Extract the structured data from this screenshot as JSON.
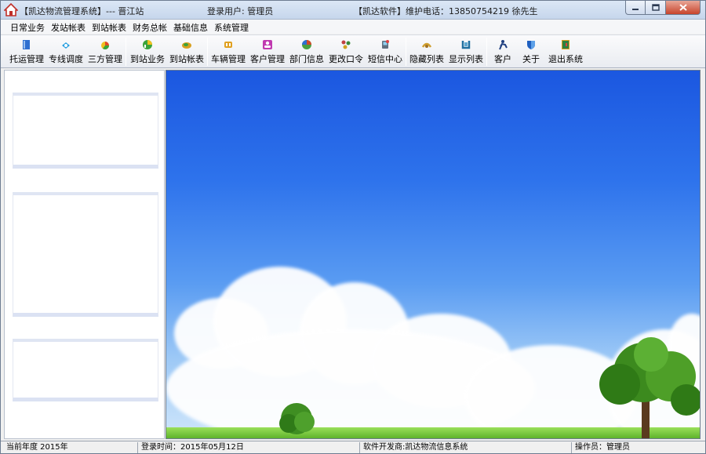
{
  "window": {
    "title_app": "【凯达物流管理系统】--- 晋江站",
    "title_user": "登录用户: 管理员",
    "title_support": "【凯达软件】维护电话：13850754219   徐先生"
  },
  "menu": [
    "日常业务",
    "发站帐表",
    "到站帐表",
    "财务总帐",
    "基础信息",
    "系统管理"
  ],
  "toolbar": [
    {
      "label": "托运管理",
      "icon": "book-icon",
      "color": "#2f6fd0"
    },
    {
      "label": "专线调度",
      "icon": "dispatch-icon",
      "color": "#2aa0e0"
    },
    {
      "label": "三方管理",
      "icon": "pie-chart-icon",
      "color": "#e04a2a"
    },
    {
      "label": "到站业务",
      "icon": "chart-icon",
      "color": "#3aa33a"
    },
    {
      "label": "到站帐表",
      "icon": "report-icon",
      "color": "#d8a020"
    },
    {
      "label": "车辆管理",
      "icon": "truck-icon",
      "color": "#e0a020"
    },
    {
      "label": "客户管理",
      "icon": "customer-icon",
      "color": "#c03ab0"
    },
    {
      "label": "部门信息",
      "icon": "department-icon",
      "color": "#d04a2a"
    },
    {
      "label": "更改口令",
      "icon": "key-icon",
      "color": "#c04040"
    },
    {
      "label": "短信中心",
      "icon": "sms-icon",
      "color": "#607080"
    },
    {
      "label": "隐藏列表",
      "icon": "hide-list-icon",
      "color": "#d0a030"
    },
    {
      "label": "显示列表",
      "icon": "show-list-icon",
      "color": "#2070a0"
    },
    {
      "label": "客户",
      "icon": "person-icon",
      "color": "#204080"
    },
    {
      "label": "关于",
      "icon": "shield-icon",
      "color": "#2060c0"
    },
    {
      "label": "退出系统",
      "icon": "exit-icon",
      "color": "#308040"
    }
  ],
  "status": {
    "year": "当前年度  2015年",
    "login_time": "登录时间：2015年05月12日",
    "developer": "软件开发商:凯达物流信息系统",
    "operator": "操作员：管理员"
  }
}
